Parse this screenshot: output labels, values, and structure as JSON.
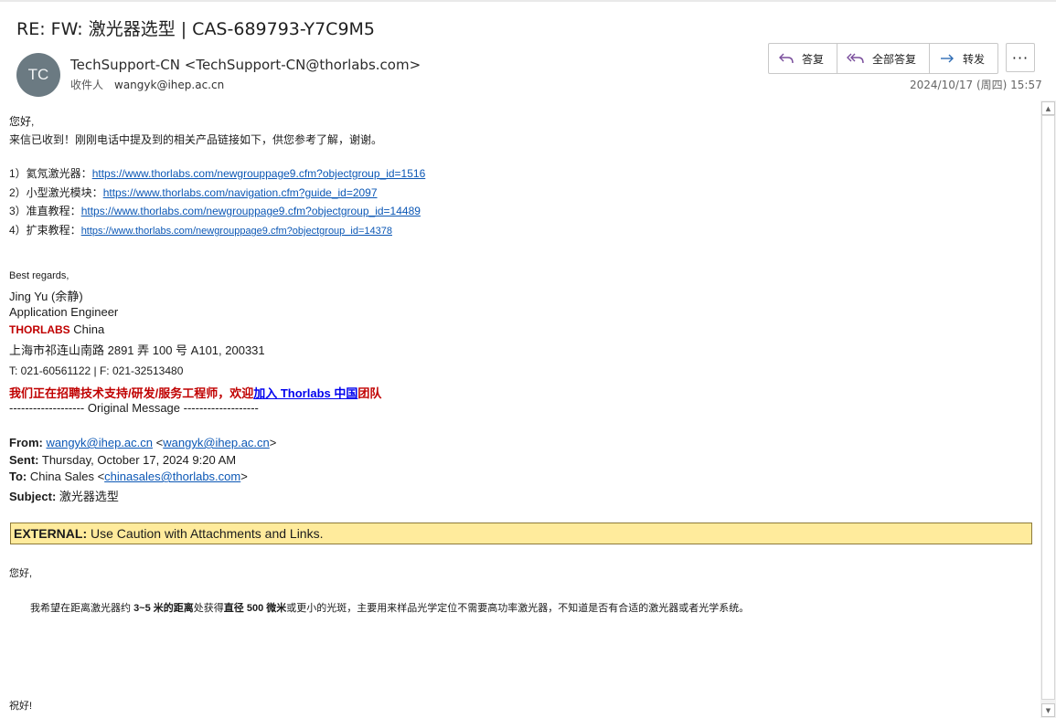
{
  "header": {
    "subject": "RE: FW: 激光器选型 | CAS-689793-Y7C9M5",
    "avatar_initials": "TC",
    "sender": "TechSupport-CN <TechSupport-CN@thorlabs.com>",
    "to_label": "收件人",
    "to_address": "wangyk@ihep.ac.cn",
    "date": "2024/10/17 (周四) 15:57",
    "actions": {
      "reply": "答复",
      "reply_all": "全部答复",
      "forward": "转发",
      "more": "···"
    }
  },
  "reply": {
    "greeting": "您好,",
    "intro": "来信已收到！刚刚电话中提及到的相关产品链接如下，供您参考了解，谢谢。",
    "links": [
      {
        "label": "1）氦氖激光器：",
        "url": "https://www.thorlabs.com/newgrouppage9.cfm?objectgroup_id=1516"
      },
      {
        "label": "2）小型激光模块：",
        "url": "https://www.thorlabs.com/navigation.cfm?guide_id=2097"
      },
      {
        "label": "3）准直教程：",
        "url": "https://www.thorlabs.com/newgrouppage9.cfm?objectgroup_id=14489"
      },
      {
        "label": "4）扩束教程：",
        "url": "https://www.thorlabs.com/newgrouppage9.cfm?objectgroup_id=14378"
      }
    ]
  },
  "signature": {
    "closing": "Best regards,",
    "name": "Jing Yu (余静)",
    "title": "Application Engineer",
    "company_brand": "THORLABS",
    "company_suffix": " China",
    "address": "上海市祁连山南路 2891 弄 100 号 A101, 200331",
    "phone": "T: 021-60561122  |  F: 021-32513480",
    "recruit_prefix": "我们正在招聘技术支持/研发/服务工程师，欢迎",
    "recruit_link": "加入 Thorlabs 中国",
    "recruit_suffix": "团队"
  },
  "original": {
    "separator": "------------------- Original Message -------------------",
    "from_label": "From:",
    "from_addr": "wangyk@ihep.ac.cn",
    "from_addr2": "wangyk@ihep.ac.cn",
    "sent_label": "Sent:",
    "sent_value": " Thursday, October 17, 2024 9:20 AM",
    "to_label": "To:",
    "to_name": " China Sales <",
    "to_addr": "chinasales@thorlabs.com",
    "subject_label": "Subject:",
    "subject_value": " 激光器选型",
    "banner_bold": "EXTERNAL:",
    "banner_text": " Use Caution with Attachments and Links.",
    "greeting": "您好,",
    "p1": "我希望在距离激光器约 ",
    "p2": "3~5 米的距离",
    "p3": "处获得",
    "p4": "直径 500 微米",
    "p5": "或更小的光斑，主要用来样品光学定位不需要高功率激光器，不知道是否有合适的激光器或者光学系统。",
    "closing": "祝好!"
  }
}
